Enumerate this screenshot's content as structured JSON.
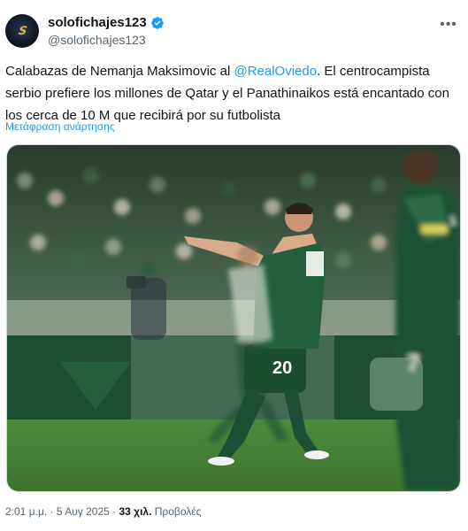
{
  "header": {
    "display_name": "solofichajes123",
    "handle": "@solofichajes123",
    "avatar_text": "S"
  },
  "tweet": {
    "text_before": "Calabazas de Nemanja Maksimovic al ",
    "mention": "@RealOviedo",
    "text_after": ". El centrocampista serbio prefiere los millones de Qatar y el Panathinaikos está encantado con los cerca de 10 M que recibirá por su futbolista",
    "translate_label": "Μετάφραση ανάρτησης"
  },
  "photo": {
    "shirt_number": "20",
    "side_number": "1",
    "right_number": "7"
  },
  "meta": {
    "time": "2:01 μ.μ.",
    "sep1": " · ",
    "date": "5 Αυγ 2025",
    "sep2": " · ",
    "views_count": "33 χιλ.",
    "views_label": " Προβολές"
  },
  "colors": {
    "link": "#1d9bf0",
    "secondary_text": "#536471",
    "kit_green": "#1f5a3a"
  }
}
